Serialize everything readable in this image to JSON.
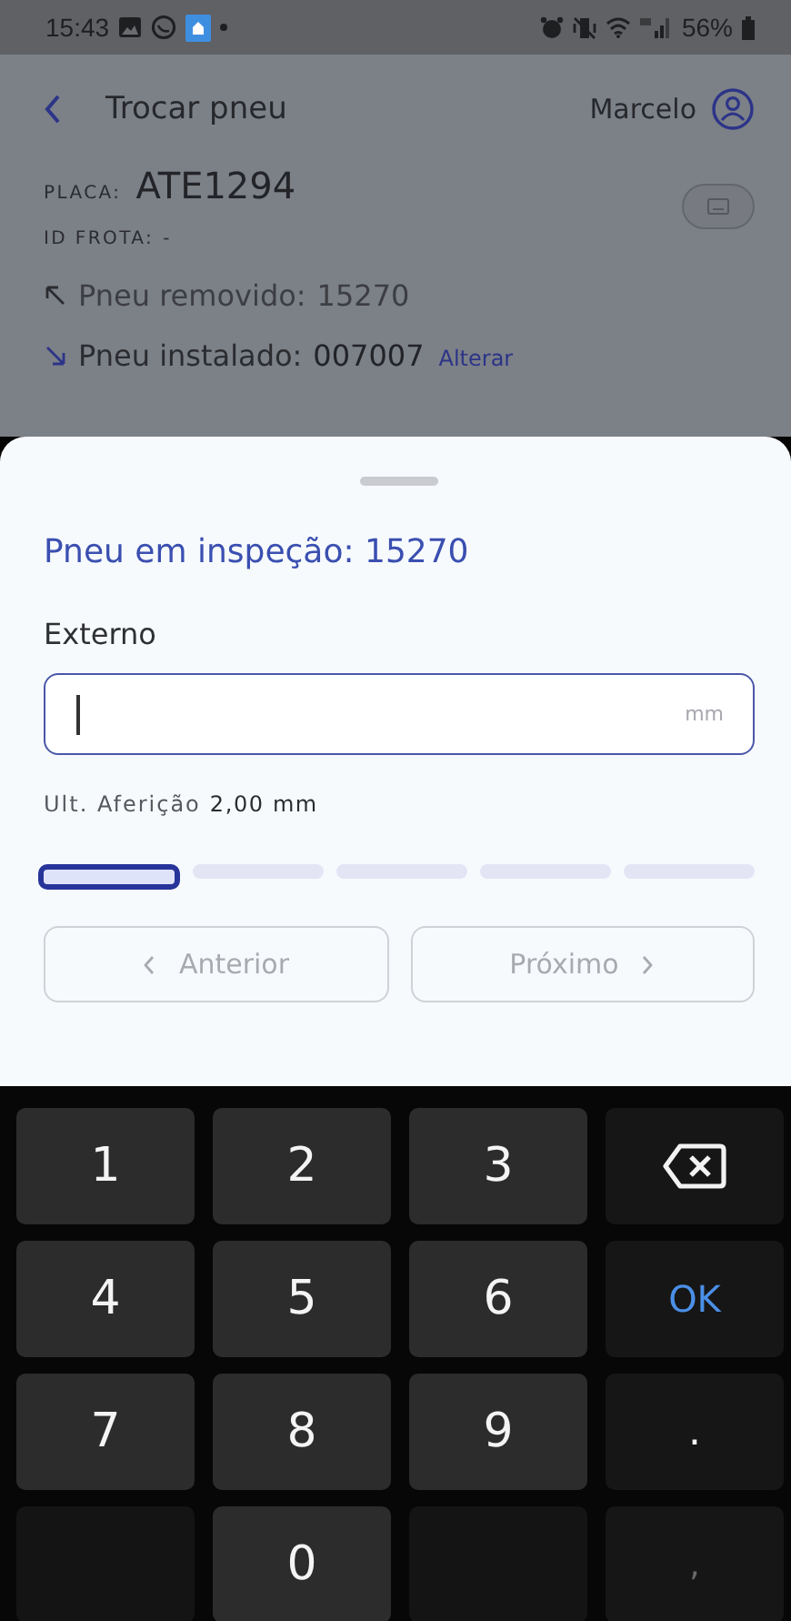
{
  "status_bar": {
    "time": "15:43",
    "battery": "56%"
  },
  "header": {
    "title": "Trocar pneu",
    "user": "Marcelo"
  },
  "vehicle": {
    "plate_label": "PLACA:",
    "plate": "ATE1294",
    "fleet_label": "ID FROTA:",
    "fleet": "-"
  },
  "tires": [
    {
      "kind": "removed",
      "label": "Pneu removido:",
      "number": "15270"
    },
    {
      "kind": "installed",
      "label": "Pneu instalado:",
      "number": "007007",
      "action": "Alterar"
    }
  ],
  "sheet": {
    "title": "Pneu em inspeção: 15270",
    "field_label": "Externo",
    "unit": "mm",
    "last_label": "Ult. Aferição",
    "last_value": "2,00 mm",
    "steps": [
      {
        "selected": true
      },
      {
        "selected": false
      },
      {
        "selected": false
      },
      {
        "selected": false
      },
      {
        "selected": false
      }
    ],
    "buttons": [
      {
        "kind": "prev",
        "label": "Anterior",
        "disabled": true
      },
      {
        "kind": "next",
        "label": "Próximo",
        "disabled": true
      }
    ]
  },
  "keyboard": {
    "keys": [
      {
        "kind": "digit",
        "label": "1"
      },
      {
        "kind": "digit",
        "label": "2"
      },
      {
        "kind": "digit",
        "label": "3"
      },
      {
        "kind": "backspace"
      },
      {
        "kind": "digit",
        "label": "4"
      },
      {
        "kind": "digit",
        "label": "5"
      },
      {
        "kind": "digit",
        "label": "6"
      },
      {
        "kind": "ok",
        "label": "OK"
      },
      {
        "kind": "digit",
        "label": "7"
      },
      {
        "kind": "digit",
        "label": "8"
      },
      {
        "kind": "digit",
        "label": "9"
      },
      {
        "kind": "symbol",
        "label": "."
      },
      {
        "kind": "blank"
      },
      {
        "kind": "digit",
        "label": "0"
      },
      {
        "kind": "blank"
      },
      {
        "kind": "faint",
        "label": ","
      }
    ]
  }
}
